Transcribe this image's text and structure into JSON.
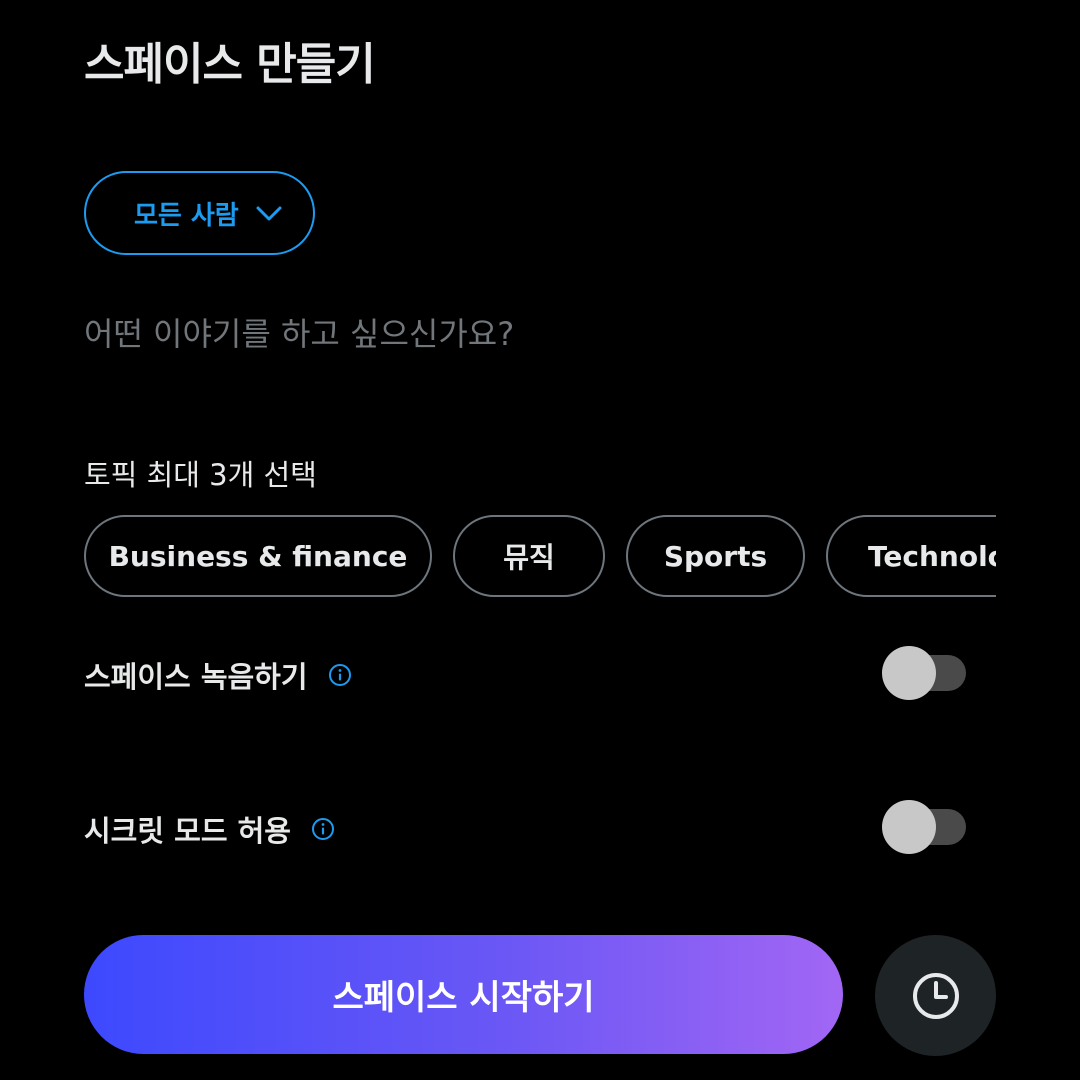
{
  "page": {
    "title": "스페이스 만들기"
  },
  "audience": {
    "label": "모든 사람",
    "icon": "chevron-down-icon"
  },
  "topic_input": {
    "placeholder": "어떤 이야기를 하고 싶으신가요?",
    "value": ""
  },
  "topics": {
    "label": "토픽 최대 3개 선택",
    "chips": [
      {
        "label": "Business & finance"
      },
      {
        "label": "뮤직"
      },
      {
        "label": "Sports"
      },
      {
        "label": "Technology"
      }
    ]
  },
  "settings": {
    "record": {
      "label": "스페이스 녹음하기",
      "enabled": false,
      "icon": "info-icon"
    },
    "incognito": {
      "label": "시크릿 모드 허용",
      "enabled": false,
      "icon": "info-icon"
    }
  },
  "actions": {
    "start_label": "스페이스 시작하기",
    "schedule_icon": "clock-icon"
  },
  "colors": {
    "accent": "#1d9bf0",
    "gradient_start": "#3d49fe",
    "gradient_end": "#a266f4",
    "background": "#000000"
  }
}
